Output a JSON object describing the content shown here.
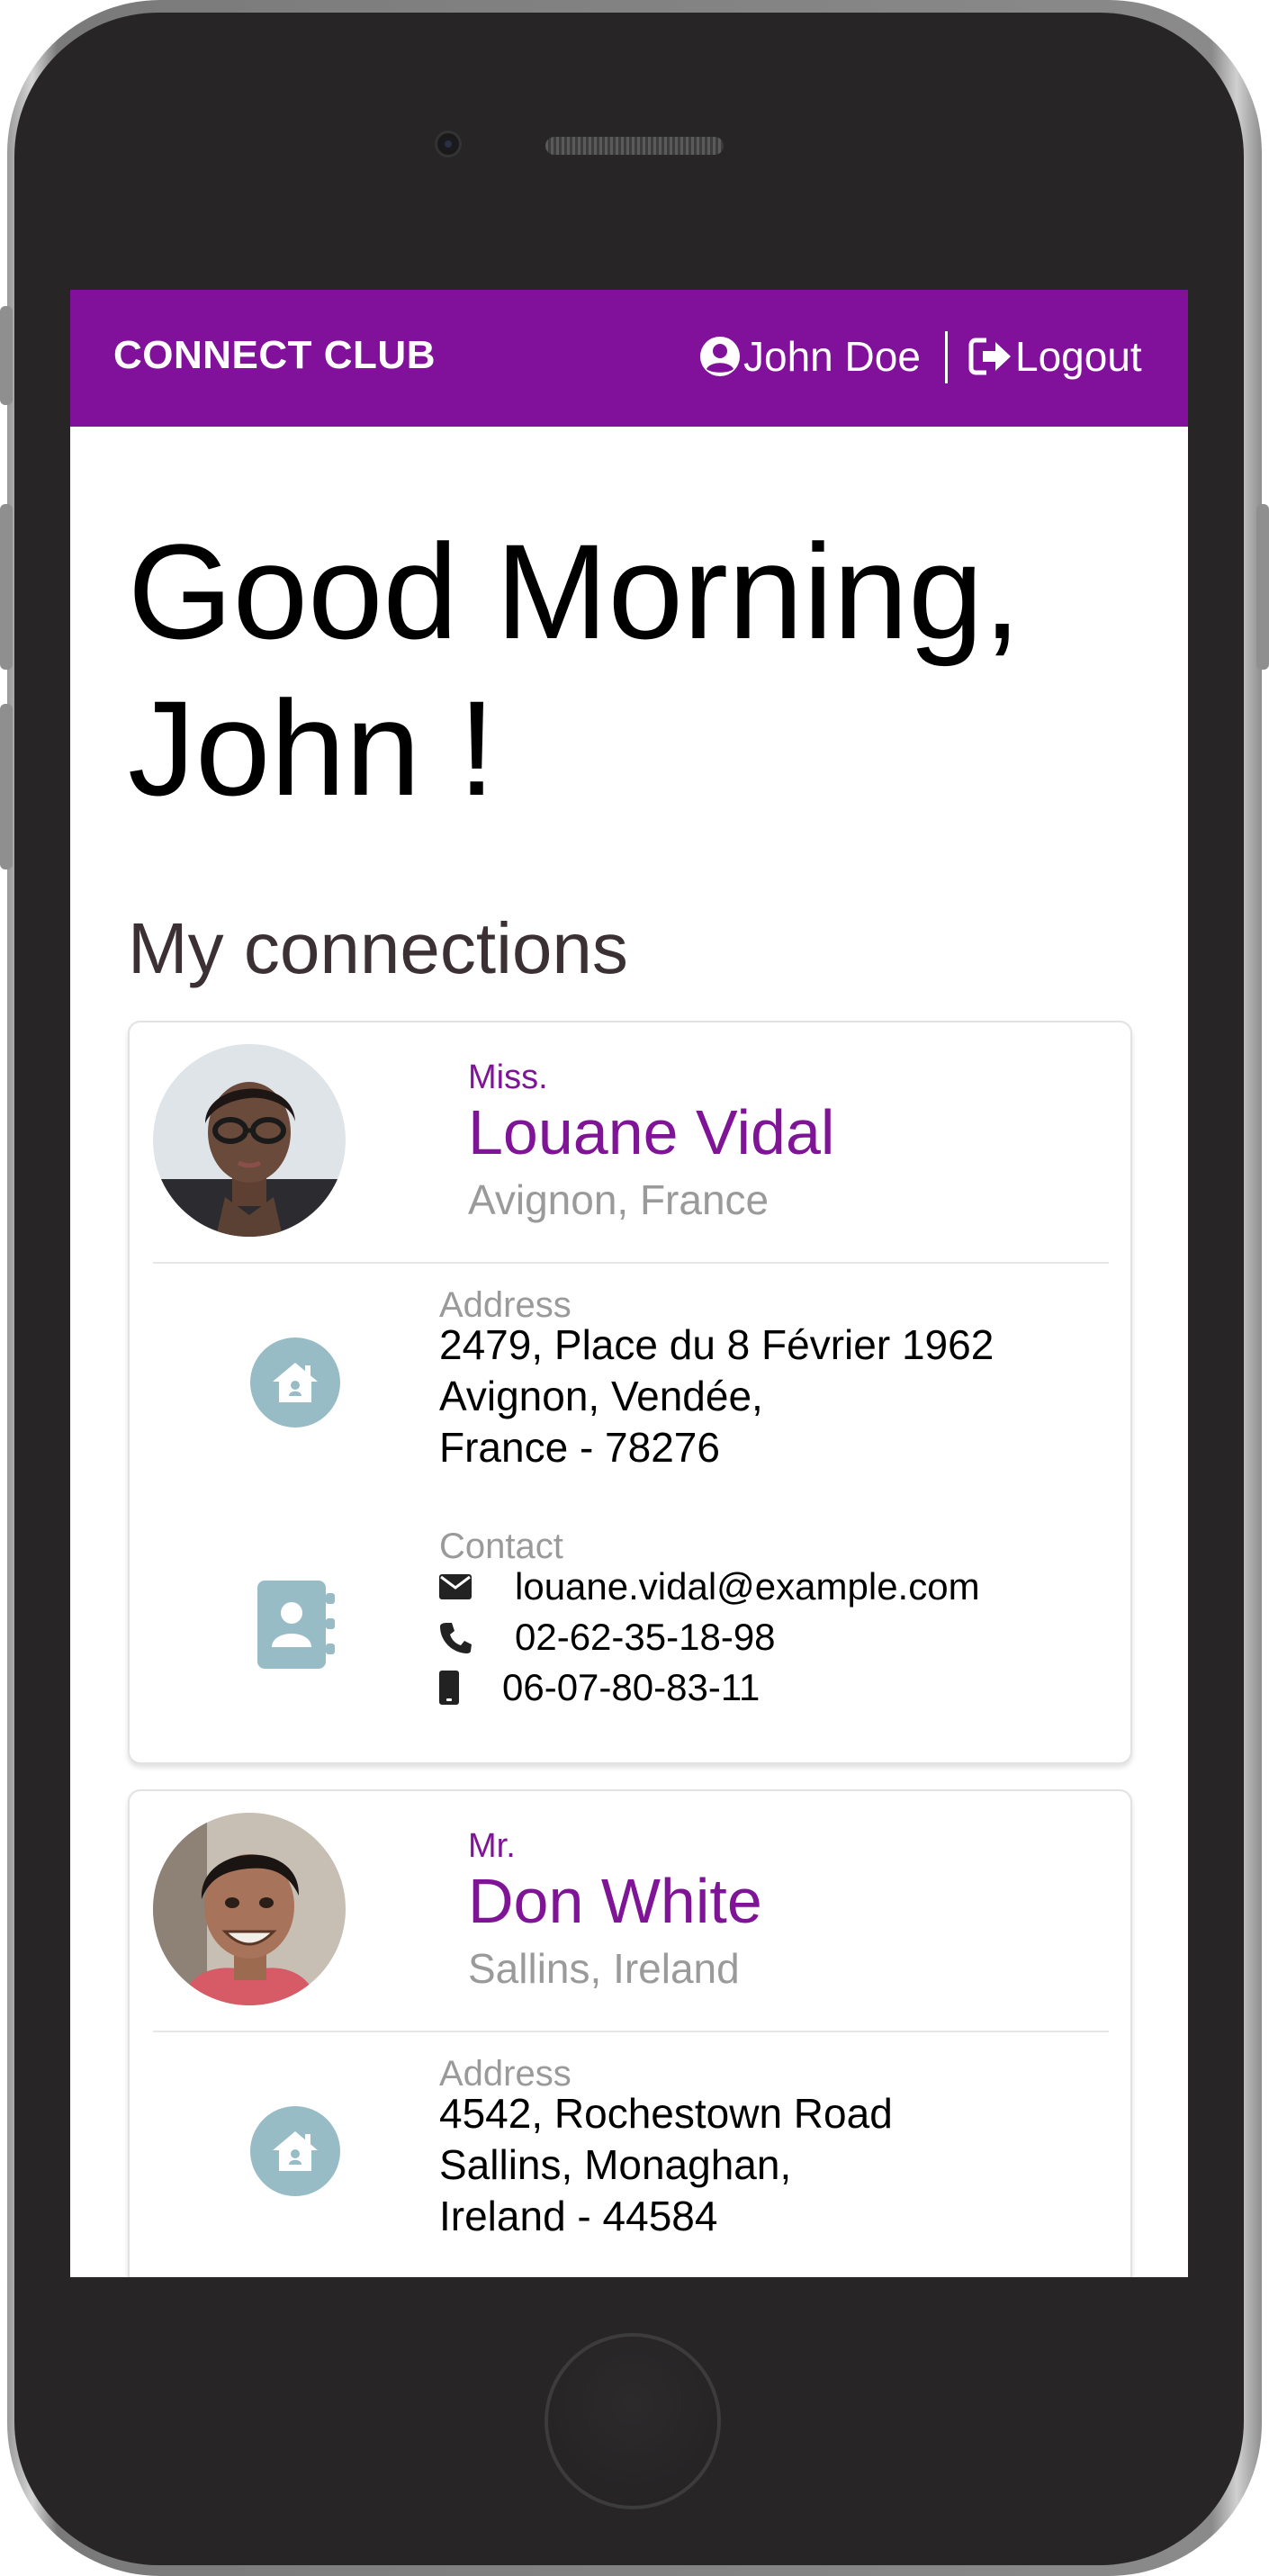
{
  "navbar": {
    "brand": "CONNECT CLUB",
    "user_name": "John Doe",
    "logout_label": "Logout",
    "background": "#81109a"
  },
  "greeting": "Good Morning, John !",
  "section_title": "My connections",
  "labels": {
    "address": "Address",
    "contact": "Contact"
  },
  "connections": [
    {
      "salutation": "Miss.",
      "name": "Louane Vidal",
      "location": "Avignon, France",
      "address_lines": [
        "2479, Place du 8 Février 1962",
        "Avignon, Vendée,",
        "France - 78276"
      ],
      "email": "louane.vidal@example.com",
      "phone": "02-62-35-18-98",
      "mobile": "06-07-80-83-11"
    },
    {
      "salutation": "Mr.",
      "name": "Don White",
      "location": "Sallins, Ireland",
      "address_lines": [
        "4542, Rochestown Road",
        "Sallins, Monaghan,",
        "Ireland - 44584"
      ]
    }
  ],
  "colors": {
    "accent": "#7f1497",
    "icon_circle": "#98bcc5",
    "muted_text": "#9a9a9a"
  }
}
